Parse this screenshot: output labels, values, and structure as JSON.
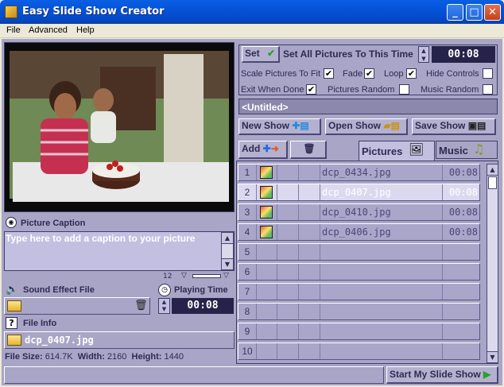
{
  "window": {
    "title": "Easy Slide Show Creator",
    "minimize": "_",
    "maximize": "□",
    "close": "✕"
  },
  "menu": [
    "File",
    "Advanced",
    "Help"
  ],
  "caption": {
    "label": "Picture Caption",
    "text": "Type here to add a caption to your picture",
    "font_size": "12"
  },
  "sound": {
    "label": "Sound Effect File"
  },
  "playing_time": {
    "label": "Playing Time",
    "value": "00:08"
  },
  "file_info": {
    "label": "File Info",
    "filename": "dcp_0407.jpg",
    "size_label": "File Size:",
    "size": "614.7K",
    "width_label": "Width:",
    "width": "2160",
    "height_label": "Height:",
    "height": "1440"
  },
  "settings": {
    "set_button": "Set",
    "set_all_label": "Set All Pictures To This Time",
    "time": "00:08",
    "options": [
      {
        "label": "Scale Pictures To Fit",
        "checked": true
      },
      {
        "label": "Fade",
        "checked": true
      },
      {
        "label": "Loop",
        "checked": true
      },
      {
        "label": "Hide Controls",
        "checked": false
      },
      {
        "label": "Exit When Done",
        "checked": true
      },
      {
        "label": "Pictures Random",
        "checked": false
      },
      {
        "label": "Music Random",
        "checked": false
      }
    ]
  },
  "show_name": "<Untitled>",
  "show_buttons": {
    "new": "New Show",
    "open": "Open Show",
    "save": "Save Show"
  },
  "list_toolbar": {
    "add": "Add",
    "pictures_tab": "Pictures",
    "music_tab": "Music"
  },
  "pictures": [
    {
      "num": "1",
      "name": "dcp_0434.jpg",
      "time": "00:08"
    },
    {
      "num": "2",
      "name": "dcp_0407.jpg",
      "time": "00:08"
    },
    {
      "num": "3",
      "name": "dcp_0410.jpg",
      "time": "00:08"
    },
    {
      "num": "4",
      "name": "dcp_0406.jpg",
      "time": "00:08"
    },
    {
      "num": "5",
      "name": "",
      "time": ""
    },
    {
      "num": "6",
      "name": "",
      "time": ""
    },
    {
      "num": "7",
      "name": "",
      "time": ""
    },
    {
      "num": "8",
      "name": "",
      "time": ""
    },
    {
      "num": "9",
      "name": "",
      "time": ""
    },
    {
      "num": "10",
      "name": "",
      "time": ""
    }
  ],
  "start_button": "Start My Slide Show",
  "check_mark": "✔",
  "colors": {
    "accent": "#3f3d6a",
    "selected_row": "#dcd9ef"
  }
}
